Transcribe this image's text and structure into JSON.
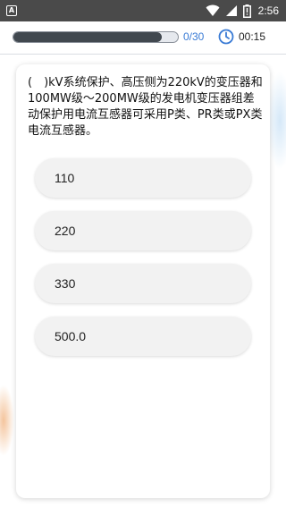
{
  "status_bar": {
    "time": "2:56",
    "notification_icon": "a-square-icon",
    "icons": [
      "wifi-icon",
      "signal-icon",
      "battery-alert-icon"
    ]
  },
  "quiz_header": {
    "progress_text": "0/30",
    "progress_fraction": 0.9,
    "timer": "00:15",
    "timer_icon": "clock-icon",
    "accent_color": "#3a7bd5"
  },
  "question": {
    "text": "(　)kV系统保护、高压侧为220kV的变压器和100MW级～200MW级的发电机变压器组差动保护用电流互感器可采用P类、PR类或PX类电流互感器。"
  },
  "options": [
    {
      "label": "110"
    },
    {
      "label": "220"
    },
    {
      "label": "330"
    },
    {
      "label": "500.0"
    }
  ]
}
